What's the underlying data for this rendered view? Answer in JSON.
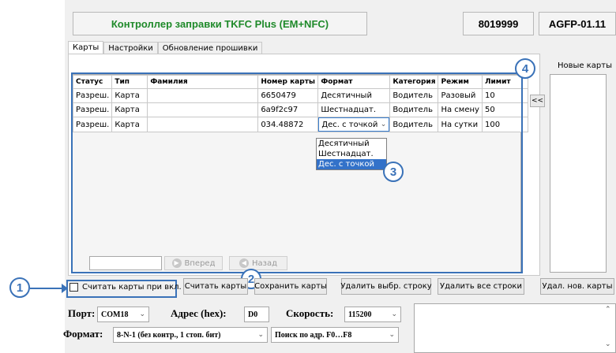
{
  "header": {
    "title": "Контроллер заправки TKFC Plus (EM+NFC)",
    "serial": "8019999",
    "model": "AGFP-01.11"
  },
  "tabs": [
    "Карты",
    "Настройки",
    "Обновление прошивки"
  ],
  "new_cards": {
    "label": "Новые карты",
    "move_button": "<<"
  },
  "table": {
    "headers": [
      "Статус",
      "Тип",
      "Фамилия",
      "Номер карты",
      "Формат",
      "Категория",
      "Режим",
      "Лимит"
    ],
    "rows": [
      [
        "Разреш.",
        "Карта",
        "",
        "6650479",
        "Десятичный",
        "Водитель",
        "Разовый",
        "10"
      ],
      [
        "Разреш.",
        "Карта",
        "",
        "6a9f2c97",
        "Шестнадцат.",
        "Водитель",
        "На смену",
        "50"
      ],
      [
        "Разреш.",
        "Карта",
        "",
        "034.48872",
        "Дес. с точкой",
        "Водитель",
        "На сутки",
        "100"
      ]
    ]
  },
  "format_dropdown": {
    "options": [
      "Десятичный",
      "Шестнадцат.",
      "Дес. с точкой"
    ],
    "selected_index": 2
  },
  "navigation": {
    "forward": "Вперед",
    "back": "Назад"
  },
  "actions": {
    "read_on_power": "Считать карты при вкл.",
    "read_cards": "Считать карты",
    "save_cards": "Сохранить карты",
    "delete_selected": "Удалить выбр. строку",
    "delete_all": "Удалить все строки",
    "delete_new": "Удал. нов. карты"
  },
  "connection": {
    "port_label": "Порт:",
    "port_value": "COM18",
    "address_label": "Адрес (hex):",
    "address_value": "D0",
    "speed_label": "Скорость:",
    "speed_value": "115200",
    "format_label": "Формат:",
    "format_value": "8-N-1 (без контр., 1 стоп. бит)",
    "search_value": "Поиск по адр. F0…F8"
  },
  "callouts": [
    "1",
    "2",
    "3",
    "4"
  ],
  "colors": {
    "callout": "#3a72b8",
    "title_green": "#1f8a2a",
    "selection": "#3372c9"
  }
}
